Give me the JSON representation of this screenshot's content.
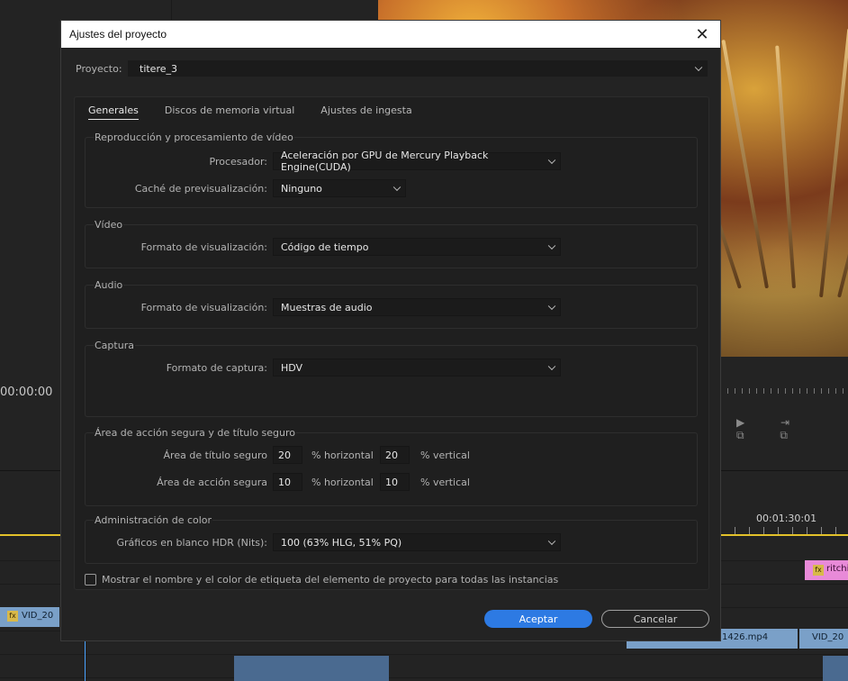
{
  "dialog": {
    "title": "Ajustes del proyecto",
    "close_icon": "close-icon"
  },
  "project": {
    "label": "Proyecto:",
    "value": "titere_3"
  },
  "tabs": [
    {
      "label": "Generales",
      "active": true
    },
    {
      "label": "Discos de memoria virtual",
      "active": false
    },
    {
      "label": "Ajustes de ingesta",
      "active": false
    }
  ],
  "sections": {
    "playback": {
      "title": "Reproducción y procesamiento de vídeo",
      "renderer_label": "Procesador:",
      "renderer_value": "Aceleración por GPU de Mercury Playback Engine(CUDA)",
      "preview_cache_label": "Caché de previsualización:",
      "preview_cache_value": "Ninguno"
    },
    "video": {
      "title": "Vídeo",
      "display_format_label": "Formato de visualización:",
      "display_format_value": "Código de tiempo"
    },
    "audio": {
      "title": "Audio",
      "display_format_label": "Formato de visualización:",
      "display_format_value": "Muestras de audio"
    },
    "capture": {
      "title": "Captura",
      "format_label": "Formato de captura:",
      "format_value": "HDV"
    },
    "safe_margins": {
      "title": "Área de acción segura y de título seguro",
      "title_safe_label": "Área de título seguro",
      "title_safe_h": "20",
      "title_safe_v": "20",
      "action_safe_label": "Área de acción segura",
      "action_safe_h": "10",
      "action_safe_v": "10",
      "horizontal_unit": "% horizontal",
      "vertical_unit": "% vertical"
    },
    "color": {
      "title": "Administración de color",
      "hdr_label": "Gráficos en blanco HDR (Nits):",
      "hdr_value": "100 (63% HLG, 51% PQ)"
    }
  },
  "checkbox": {
    "label": "Mostrar el nombre y el color de etiqueta del elemento de proyecto para todas las instancias",
    "checked": false
  },
  "buttons": {
    "ok": "Aceptar",
    "cancel": "Cancelar"
  },
  "background": {
    "timecode_left": "00:00:00",
    "timecode_right": "00:01:30:01",
    "clip_vid_left": "VID_20",
    "clip_ritchi": "ritchi",
    "clip_mp4": "1426.mp4",
    "clip_vid_right": "VID_20",
    "fx_badge": "fx"
  },
  "colors": {
    "accent_button": "#2d7ae3",
    "dialog_bg": "#232323",
    "playhead": "#e3c12a",
    "clip_video": "#7aa0c8",
    "clip_pink": "#e88ad8"
  }
}
